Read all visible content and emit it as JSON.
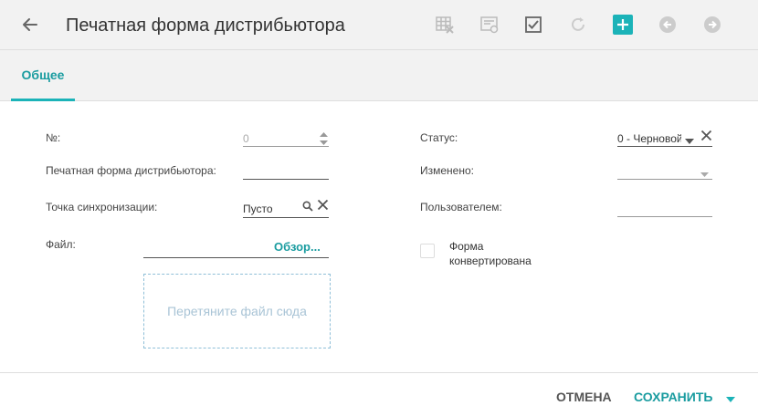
{
  "header": {
    "title": "Печатная форма дистрибьютора"
  },
  "tabs": [
    {
      "label": "Общее",
      "active": true
    }
  ],
  "form": {
    "number": {
      "label": "№:",
      "value": "0"
    },
    "print_form": {
      "label": "Печатная форма дистрибьютора:",
      "value": ""
    },
    "sync_point": {
      "label": "Точка синхронизации:",
      "value": "Пусто"
    },
    "file": {
      "label": "Файл:",
      "browse_label": "Обзор...",
      "dropzone_text": "Перетяните файл сюда"
    },
    "status": {
      "label": "Статус:",
      "value": "0 - Черновой"
    },
    "changed": {
      "label": "Изменено:",
      "value": ""
    },
    "by_user": {
      "label": "Пользователем:",
      "value": ""
    },
    "converted": {
      "label": "Форма конвертирована",
      "checked": false
    }
  },
  "footer": {
    "cancel_label": "ОТМЕНА",
    "save_label": "СОХРАНИТЬ"
  },
  "colors": {
    "accent": "#1bb3b8",
    "accent_text": "#1a9ca0",
    "header_bg": "#f2f2f2"
  }
}
